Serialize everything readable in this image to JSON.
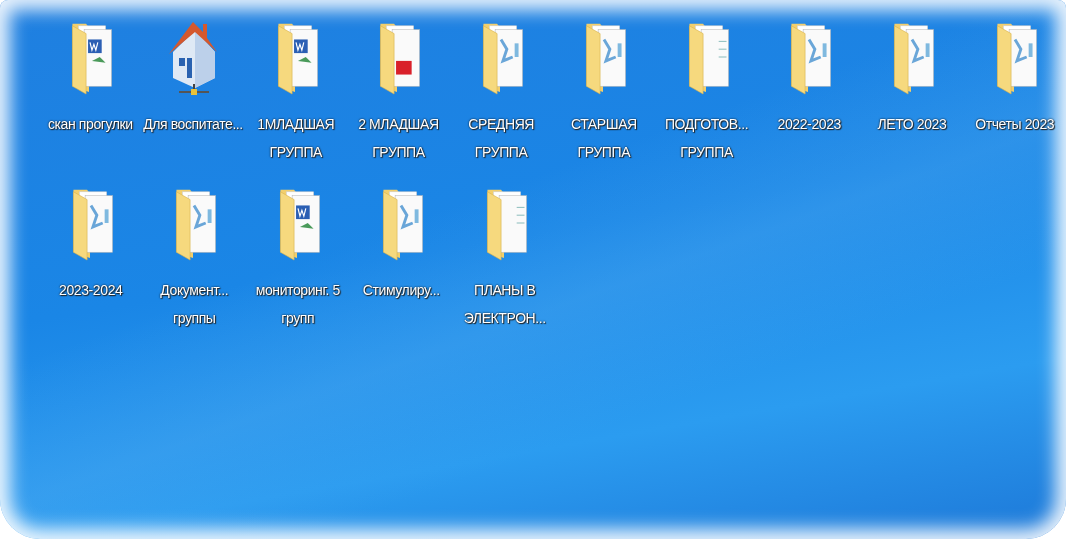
{
  "desktop": {
    "rows": [
      {
        "icons": [
          {
            "kind": "word",
            "label": "скан прогулки"
          },
          {
            "kind": "network-home",
            "label": "Для воспитате..."
          },
          {
            "kind": "word",
            "label": "1МЛАДШАЯ ГРУППА"
          },
          {
            "kind": "pdf",
            "label": "2 МЛАДШАЯ ГРУППА"
          },
          {
            "kind": "pictures",
            "label": "СРЕДНЯЯ ГРУППА"
          },
          {
            "kind": "pictures",
            "label": "СТАРШАЯ ГРУППА"
          },
          {
            "kind": "plain",
            "label": "ПОДГОТОВ... ГРУППА"
          },
          {
            "kind": "pictures",
            "label": "2022-2023"
          },
          {
            "kind": "pictures",
            "label": "ЛЕТО 2023"
          },
          {
            "kind": "pictures",
            "label": "Отчеты 2023"
          }
        ]
      },
      {
        "icons": [
          {
            "kind": "pictures",
            "label": "2023-2024"
          },
          {
            "kind": "pictures",
            "label": "Документ... группы"
          },
          {
            "kind": "word",
            "label": "мониторинг. 5 групп"
          },
          {
            "kind": "pictures",
            "label": "Стимулиру..."
          },
          {
            "kind": "plain",
            "label": "ПЛАНЫ В ЭЛЕКТРОН..."
          }
        ]
      }
    ]
  }
}
